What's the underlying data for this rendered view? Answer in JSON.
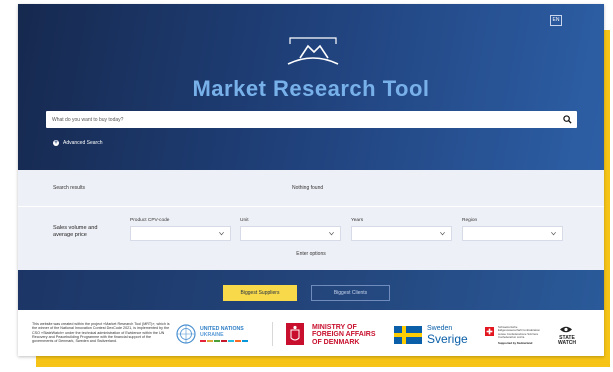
{
  "header": {
    "title": "Market Research Tool",
    "lang_button": "EN",
    "search_placeholder": "What do you want to buy today?",
    "advanced_search": "Advanced Search"
  },
  "results": {
    "label": "Search results",
    "value": "Nothing found"
  },
  "filters": {
    "sales_label": "Sales volume and average price",
    "product_label": "Product CPV-code",
    "unit_label": "Unit",
    "years_label": "Years",
    "region_label": "Region",
    "enter_options": "Enter options"
  },
  "tabs": {
    "suppliers": "Biggest Suppliers",
    "clients": "Biggest Clients",
    "active": "suppliers"
  },
  "footer": {
    "disclaimer": "This website was created within the project «Market Research Tool (MRT)», which is the winner of the National Innovation Contest DexCode 2021, is implemented by the CSO «StateWatch» under the technical administration of Ewidence within the UN Recovery and Peacebuilding Programme with the financial support of the governments of Denmark, Sweden and Switzerland.",
    "un_line1": "UNITED NATIONS",
    "un_line2": "UKRAINE",
    "dk_line1": "MINISTRY OF",
    "dk_line2": "FOREIGN AFFAIRS",
    "dk_line3": "OF DENMARK",
    "se_line1": "Sweden",
    "se_line2": "Sverige",
    "ch_text": "Schweizerische Eidgenossenschaft Confédération suisse Confederazione Svizzera Confederaziun svizra",
    "ch_support": "Supported by Switzerland",
    "sw_line1": "STATE",
    "sw_line2": "WATCH"
  },
  "colors": {
    "hero_dark": "#16294f",
    "hero_light": "#2d5fa6",
    "accent_title": "#78b1ea",
    "frame_yellow": "#f6c416",
    "tab_active": "#f8d94a",
    "denmark_red": "#c8102e",
    "sweden_blue": "#0a5fa8"
  },
  "icons": [
    "mountain-logo-icon",
    "search-icon",
    "plus-circle-icon",
    "chevron-down-icon",
    "un-emblem-icon",
    "denmark-crest-icon",
    "sweden-flag-icon",
    "swiss-cross-icon",
    "statewatch-eye-icon"
  ]
}
